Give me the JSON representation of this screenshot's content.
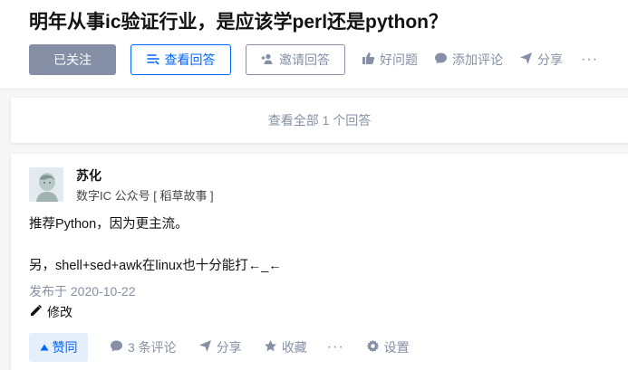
{
  "question": {
    "title": "明年从事ic验证行业，是应该学perl还是python？"
  },
  "actions": {
    "followed": "已关注",
    "view_answers": "查看回答",
    "invite_answer": "邀请回答",
    "good_question": "好问题",
    "add_comment": "添加评论",
    "share": "分享",
    "more": "···"
  },
  "view_all": {
    "label": "查看全部 1 个回答"
  },
  "answer": {
    "author": {
      "name": "苏化",
      "bio": "数字IC 公众号 [ 稻草故事 ]"
    },
    "paragraphs": [
      "推荐Python，因为更主流。",
      "另，shell+sed+awk在linux也十分能打←_←"
    ],
    "published": "发布于 2020-10-22",
    "edit": "修改",
    "bar": {
      "vote": "赞同",
      "comments": "3 条评论",
      "share": "分享",
      "favorite": "收藏",
      "more": "···",
      "settings": "设置"
    }
  },
  "colors": {
    "brand": "#0066ff",
    "muted": "#8590a6",
    "vote_bg": "#e5eefb"
  }
}
